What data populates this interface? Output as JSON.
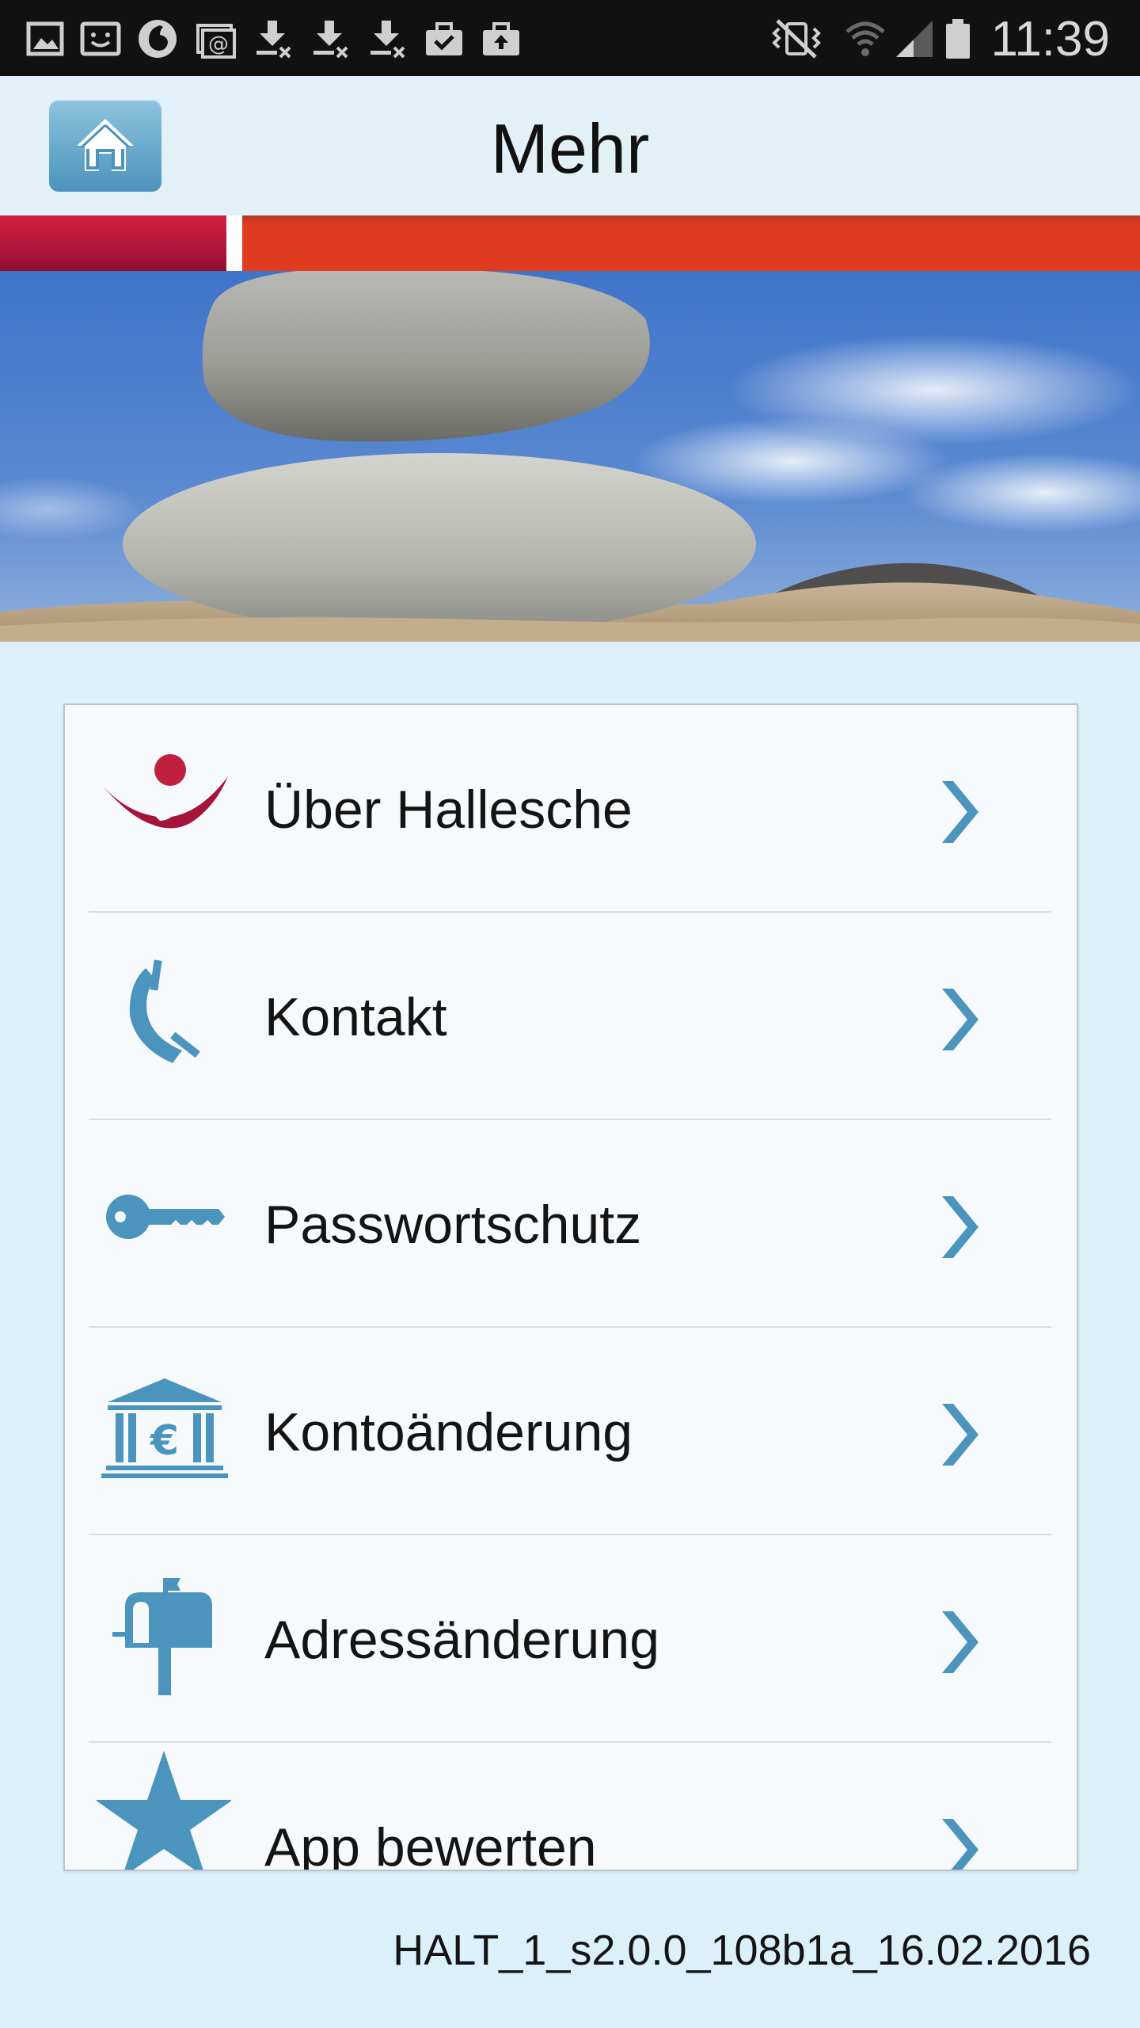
{
  "status_bar": {
    "time": "11:39",
    "left_icons": [
      "image-icon",
      "face-icon",
      "vodafone-icon",
      "email-at-icon",
      "download-icon",
      "download-icon",
      "download-icon",
      "briefcase-icon",
      "briefcase-upload-icon"
    ],
    "right_icons": [
      "vibrate-mute-icon",
      "wifi-icon",
      "signal-icon",
      "battery-icon"
    ]
  },
  "header": {
    "title": "Mehr",
    "home_icon": "home-icon"
  },
  "stripe_colors": {
    "dark": "#a9153a",
    "orange": "#e03c1f"
  },
  "menu": {
    "items": [
      {
        "label": "Über Hallesche",
        "icon": "hallesche-logo-icon"
      },
      {
        "label": "Kontakt",
        "icon": "phone-icon"
      },
      {
        "label": "Passwortschutz",
        "icon": "key-icon"
      },
      {
        "label": "Kontoänderung",
        "icon": "bank-euro-icon"
      },
      {
        "label": "Adressänderung",
        "icon": "mailbox-icon"
      },
      {
        "label": "App bewerten",
        "icon": "star-icon"
      }
    ]
  },
  "footer": {
    "version": "HALT_1_s2.0.0_108b1a_16.02.2016"
  },
  "colors": {
    "accent_blue": "#4a94bd",
    "background": "#dcf0fa"
  }
}
